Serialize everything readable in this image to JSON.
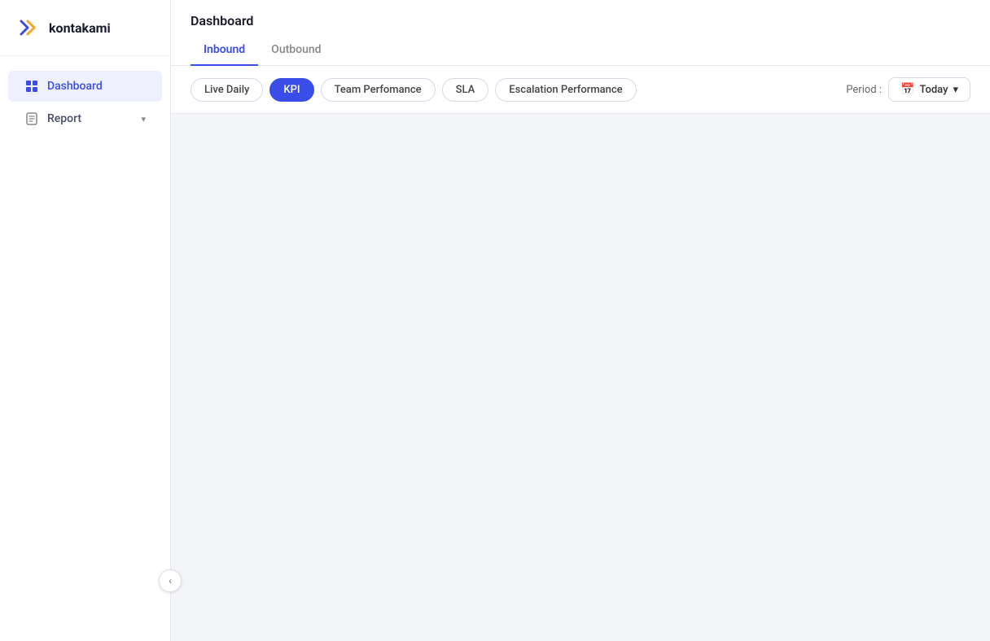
{
  "app": {
    "logo_text": "kontakami"
  },
  "sidebar": {
    "nav_items": [
      {
        "id": "dashboard",
        "label": "Dashboard",
        "active": true,
        "has_chevron": false
      },
      {
        "id": "report",
        "label": "Report",
        "active": false,
        "has_chevron": true
      }
    ]
  },
  "header": {
    "page_title": "Dashboard"
  },
  "tabs": [
    {
      "id": "inbound",
      "label": "Inbound",
      "active": true
    },
    {
      "id": "outbound",
      "label": "Outbound",
      "active": false
    }
  ],
  "pills": [
    {
      "id": "live-daily",
      "label": "Live Daily",
      "active": false
    },
    {
      "id": "kpi",
      "label": "KPI",
      "active": true
    },
    {
      "id": "team-performance",
      "label": "Team Perfomance",
      "active": false
    },
    {
      "id": "sla",
      "label": "SLA",
      "active": false
    },
    {
      "id": "escalation-performance",
      "label": "Escalation Performance",
      "active": false
    }
  ],
  "period": {
    "label": "Period :",
    "value": "Today",
    "chevron": "▾"
  },
  "sidebar_toggle": {
    "icon": "‹"
  }
}
